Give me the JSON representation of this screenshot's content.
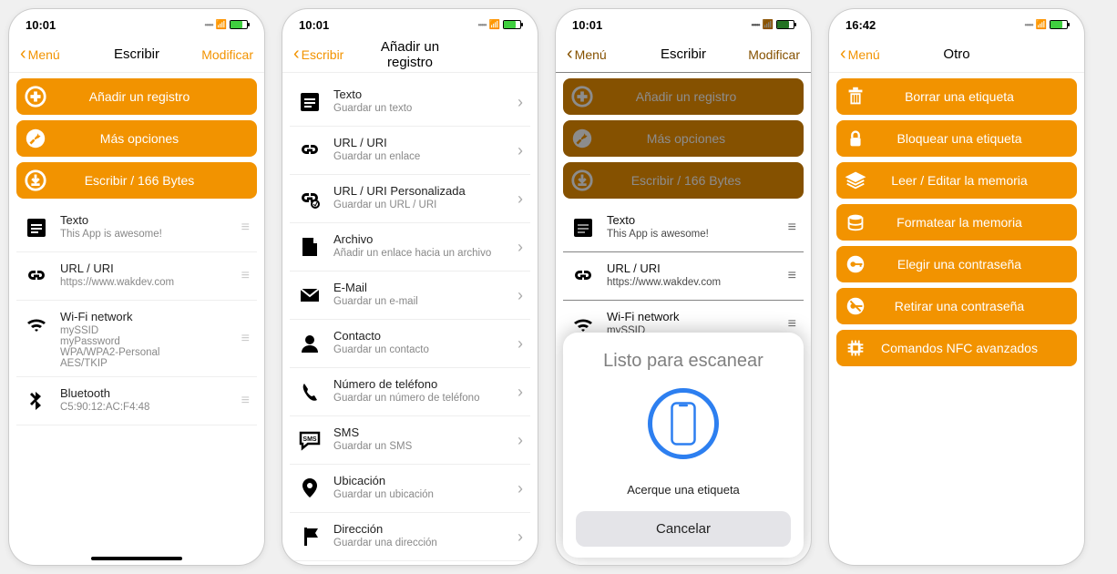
{
  "colors": {
    "accent": "#f29300",
    "sheetBtn": "#e4e4e8",
    "scanRing": "#2d7ff0"
  },
  "s1": {
    "time": "10:01",
    "nav": {
      "back": "Menú",
      "title": "Escribir",
      "right": "Modificar"
    },
    "actions": [
      {
        "icon": "plus-circle",
        "label": "Añadir un registro"
      },
      {
        "icon": "wrench-circle",
        "label": "Más opciones"
      },
      {
        "icon": "download-circle",
        "label": "Escribir / 166 Bytes"
      }
    ],
    "records": [
      {
        "icon": "text",
        "title": "Texto",
        "sub": "This App is awesome!"
      },
      {
        "icon": "link",
        "title": "URL / URI",
        "sub": "https://www.wakdev.com"
      },
      {
        "icon": "wifi",
        "title": "Wi-Fi network",
        "sub": "mySSID\nmyPassword\nWPA/WPA2-Personal\nAES/TKIP"
      },
      {
        "icon": "bluetooth",
        "title": "Bluetooth",
        "sub": "C5:90:12:AC:F4:48"
      }
    ]
  },
  "s2": {
    "time": "10:01",
    "nav": {
      "back": "Escribir",
      "title": "Añadir un registro",
      "right": ""
    },
    "types": [
      {
        "icon": "text",
        "title": "Texto",
        "sub": "Guardar un texto"
      },
      {
        "icon": "link",
        "title": "URL / URI",
        "sub": "Guardar un enlace"
      },
      {
        "icon": "link-custom",
        "title": "URL / URI Personalizada",
        "sub": "Guardar un URL / URI"
      },
      {
        "icon": "file",
        "title": "Archivo",
        "sub": "Añadir un enlace hacia un archivo"
      },
      {
        "icon": "mail",
        "title": "E-Mail",
        "sub": "Guardar un e-mail"
      },
      {
        "icon": "contact",
        "title": "Contacto",
        "sub": "Guardar un contacto"
      },
      {
        "icon": "phone",
        "title": "Número de teléfono",
        "sub": "Guardar un número de teléfono"
      },
      {
        "icon": "sms",
        "title": "SMS",
        "sub": "Guardar un SMS"
      },
      {
        "icon": "location",
        "title": "Ubicación",
        "sub": "Guardar un ubicación"
      },
      {
        "icon": "address",
        "title": "Dirección",
        "sub": "Guardar una dirección"
      }
    ]
  },
  "s3": {
    "time": "10:01",
    "nav": {
      "back": "Menú",
      "title": "Escribir",
      "right": "Modificar"
    },
    "actions": [
      {
        "icon": "plus-circle",
        "label": "Añadir un registro"
      },
      {
        "icon": "wrench-circle",
        "label": "Más opciones"
      },
      {
        "icon": "download-circle",
        "label": "Escribir / 166 Bytes"
      }
    ],
    "records": [
      {
        "icon": "text",
        "title": "Texto",
        "sub": "This App is awesome!"
      },
      {
        "icon": "link",
        "title": "URL / URI",
        "sub": "https://www.wakdev.com"
      },
      {
        "icon": "wifi",
        "title": "Wi-Fi network",
        "sub": "mySSID"
      }
    ],
    "sheet": {
      "title": "Listo para escanear",
      "hint": "Acerque una etiqueta",
      "cancel": "Cancelar"
    }
  },
  "s4": {
    "time": "16:42",
    "nav": {
      "back": "Menú",
      "title": "Otro",
      "right": ""
    },
    "actions": [
      {
        "icon": "trash",
        "label": "Borrar una etiqueta"
      },
      {
        "icon": "lock",
        "label": "Bloquear una etiqueta"
      },
      {
        "icon": "layers",
        "label": "Leer / Editar la memoria"
      },
      {
        "icon": "db",
        "label": "Formatear la memoria"
      },
      {
        "icon": "key",
        "label": "Elegir una contraseña"
      },
      {
        "icon": "key-remove",
        "label": "Retirar una contraseña"
      },
      {
        "icon": "chip",
        "label": "Comandos NFC avanzados"
      }
    ]
  }
}
